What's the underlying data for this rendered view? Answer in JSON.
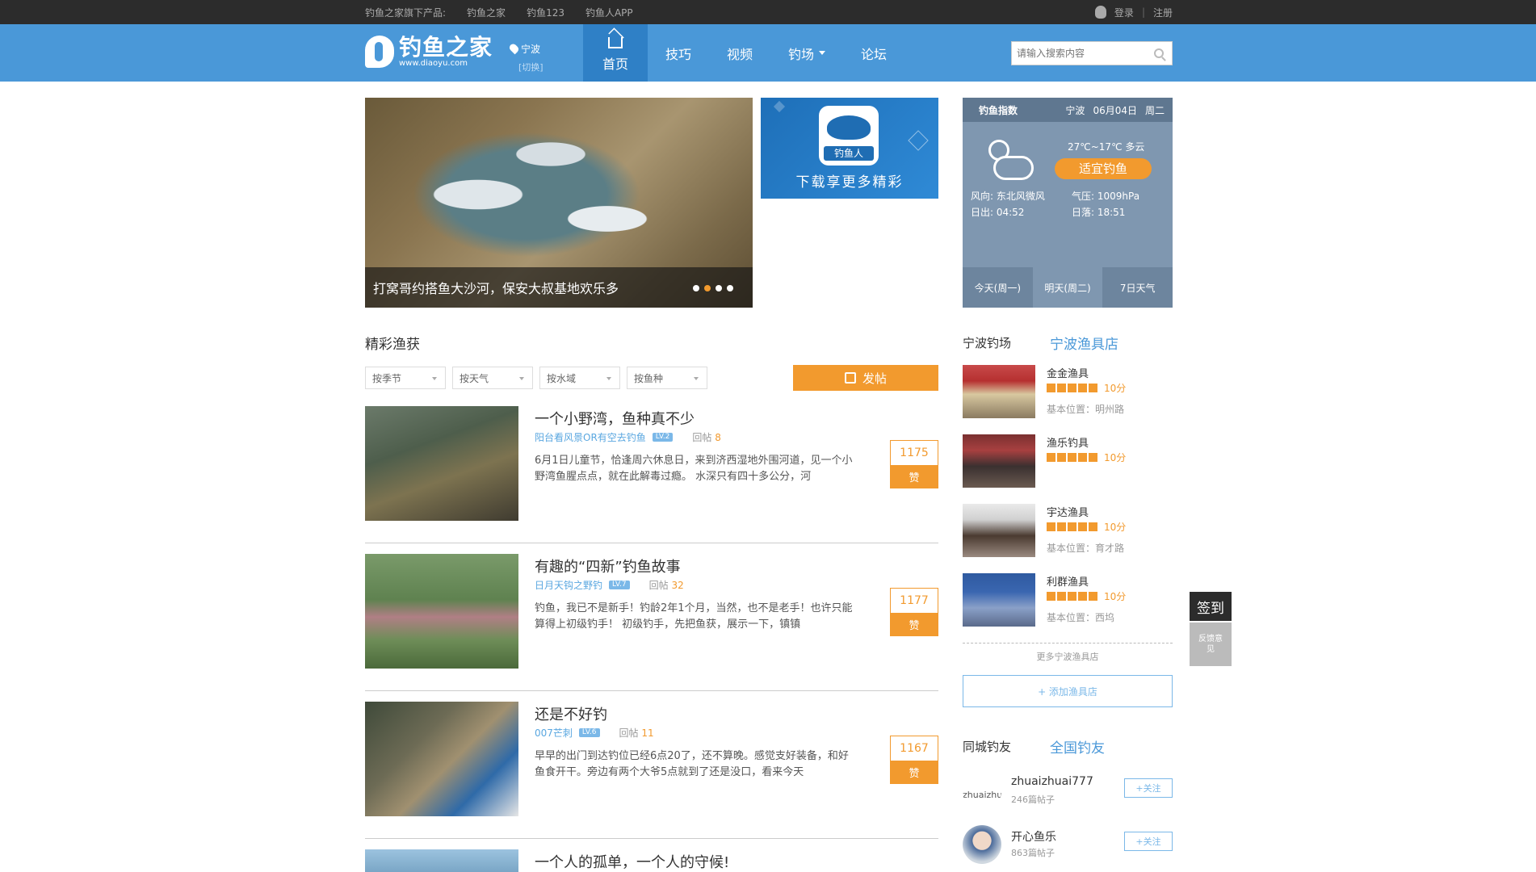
{
  "topbar": {
    "products_label": "钓鱼之家旗下产品:",
    "links": [
      "钓鱼之家",
      "钓鱼123",
      "钓鱼人APP"
    ],
    "login": "登录",
    "sep": "|",
    "register": "注册"
  },
  "header": {
    "logo_cn": "钓鱼之家",
    "logo_en": "www.diaoyu.com",
    "city": "宁波",
    "switch": "[切换]",
    "nav": [
      "首页",
      "技巧",
      "视频",
      "钓场",
      "论坛"
    ],
    "search_placeholder": "请输入搜索内容"
  },
  "banner": {
    "caption": "打窝哥约搭鱼大沙河，保安大叔基地欢乐多",
    "dots": 4,
    "active_dot": 1
  },
  "app_ad": {
    "icon_label": "钓鱼人",
    "text": "下载享更多精彩"
  },
  "weather": {
    "title": "钓鱼指数",
    "city": "宁波",
    "date": "06月04日",
    "weekday": "周二",
    "temp": "27℃~17℃ 多云",
    "fit": "适宜钓鱼",
    "wind": "风向: 东北风微风",
    "pressure": "气压: 1009hPa",
    "sunrise": "日出: 04:52",
    "sunset": "日落: 18:51",
    "tabs": [
      "今天(周一)",
      "明天(周二)",
      "7日天气"
    ]
  },
  "catch": {
    "title": "精彩渔获",
    "filters": [
      "按季节",
      "按天气",
      "按水域",
      "按鱼种"
    ],
    "post_button": "发帖",
    "posts": [
      {
        "title": "一个小野湾，鱼种真不少",
        "author": "阳台看风景OR有空去钓鱼",
        "level": "LV.2",
        "replies_label": "回帖",
        "replies": "8",
        "excerpt": "6月1日儿童节，恰逢周六休息日，来到济西湿地外围河道，见一个小野湾鱼腥点点，就在此解毒过瘾。 水深只有四十多公分，河",
        "likes": "1175",
        "like_label": "赞"
      },
      {
        "title": "有趣的“四新”钓鱼故事",
        "author": "日月天钩之野钓",
        "level": "LV.7",
        "replies_label": "回帖",
        "replies": "32",
        "excerpt": "钓鱼，我已不是新手！钓龄2年1个月，当然，也不是老手！也许只能算得上初级钓手！ 初级钓手，先把鱼获，展示一下，镇镇",
        "likes": "1177",
        "like_label": "赞"
      },
      {
        "title": "还是不好钓",
        "author": "007芒刺",
        "level": "LV.6",
        "replies_label": "回帖",
        "replies": "11",
        "excerpt": "早早的出门到达钓位已经6点20了，还不算晚。感觉支好装备，和好鱼食开干。旁边有两个大爷5点就到了还是没口，看来今天",
        "likes": "1167",
        "like_label": "赞"
      },
      {
        "title": "一个人的孤单，一个人的守候!",
        "author": "",
        "level": "",
        "replies_label": "",
        "replies": "",
        "excerpt": "",
        "likes": "",
        "like_label": ""
      }
    ]
  },
  "shops": {
    "tab_a": "宁波钓场",
    "tab_b": "宁波渔具店",
    "items": [
      {
        "name": "金金渔具",
        "score": "10分",
        "address": "基本位置：明州路"
      },
      {
        "name": "渔乐钓具",
        "score": "10分",
        "address": ""
      },
      {
        "name": "宇达渔具",
        "score": "10分",
        "address": "基本位置：育才路"
      },
      {
        "name": "利群渔具",
        "score": "10分",
        "address": "基本位置：西坞"
      }
    ],
    "more": "更多宁波渔具店",
    "add": "+ 添加渔具店"
  },
  "friends": {
    "tab_a": "同城钓友",
    "tab_b": "全国钓友",
    "items": [
      {
        "avatar_text": "zhuaizhu",
        "name": "zhuaizhuai777",
        "posts": "246篇帖子",
        "follow": "+关注"
      },
      {
        "avatar_text": "",
        "name": "开心鱼乐",
        "posts": "863篇帖子",
        "follow": "+关注"
      }
    ]
  },
  "float": {
    "sign": "签到",
    "feedback": "反馈意见"
  },
  "colors": {
    "brand": "#4a98d8",
    "accent": "#f29a2e",
    "topbar": "#2c2c2c"
  }
}
